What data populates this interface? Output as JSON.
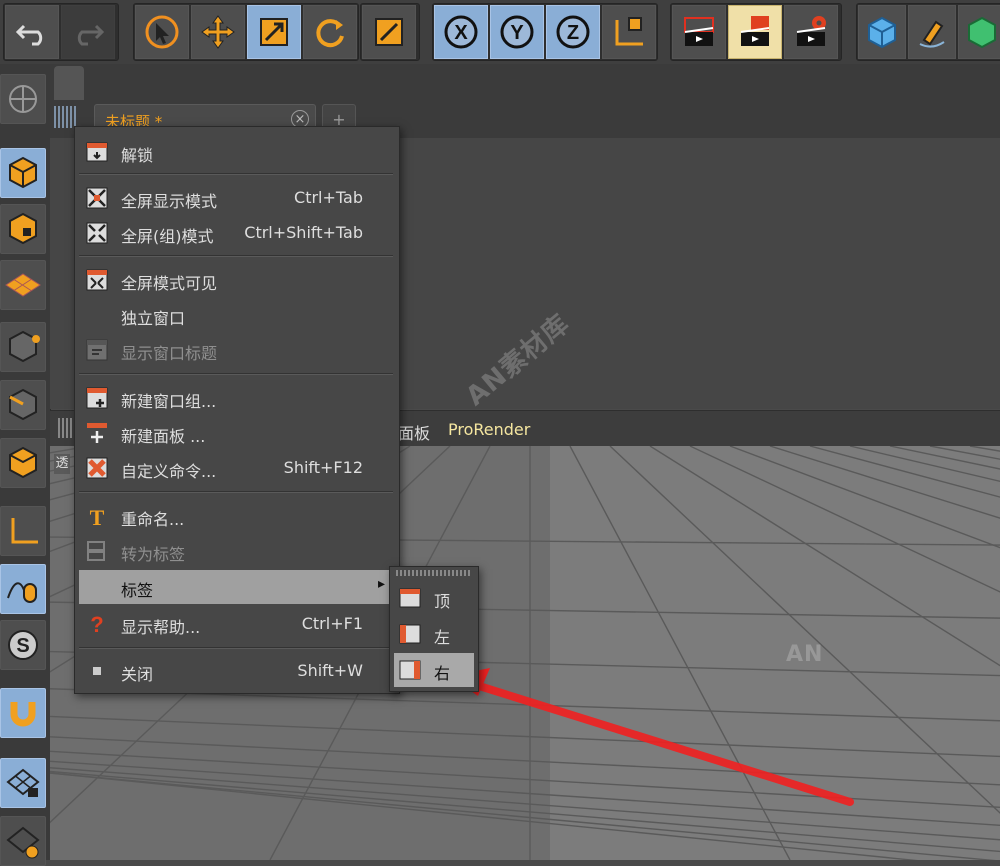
{
  "app": {
    "document_tab": "未标题 *",
    "document_tab_close": "⊗",
    "new_tab": "+"
  },
  "viewport_menu": {
    "items": [
      "面板",
      "ProRender"
    ],
    "colors": {
      "panel": "#dcdcdc",
      "prorender": "#f5e6a0"
    },
    "edge_label": "透"
  },
  "toolbar_icons": [
    "undo-icon",
    "redo-icon",
    "select-icon",
    "move-icon",
    "scale-icon",
    "rotate-icon",
    "coord-icon",
    "x-axis-icon",
    "y-axis-icon",
    "z-axis-icon",
    "world-coordinate-icon",
    "render-view-icon",
    "render-to-picture-viewer-icon",
    "render-settings-icon",
    "cube-icon",
    "pen-icon",
    "green-cube-icon"
  ],
  "left_toolbar_icons": [
    "mode-model-icon",
    "object-mode-icon",
    "texture-mode-icon",
    "workplane-icon",
    "points-icon",
    "edges-icon",
    "polygons-icon",
    "axis-icon",
    "tweak-icon",
    "snap-icon",
    "magnet-icon",
    "lock-grid-icon",
    "workplane-lock-icon"
  ],
  "context_menu": {
    "groups": [
      [
        {
          "label": "解锁",
          "shortcut": "",
          "icon": "unlock-icon",
          "disabled": false
        }
      ],
      [
        {
          "label": "全屏显示模式",
          "shortcut": "Ctrl+Tab",
          "icon": "fullscreen-icon",
          "disabled": false
        },
        {
          "label": "全屏(组)模式",
          "shortcut": "Ctrl+Shift+Tab",
          "icon": "fullscreen-group-icon",
          "disabled": false
        }
      ],
      [
        {
          "label": "全屏模式可见",
          "shortcut": "",
          "icon": "fullscreen-visible-icon",
          "disabled": false
        },
        {
          "label": "独立窗口",
          "shortcut": "",
          "icon": "",
          "disabled": false
        },
        {
          "label": "显示窗口标题",
          "shortcut": "",
          "icon": "window-title-icon",
          "disabled": true
        }
      ],
      [
        {
          "label": "新建窗口组...",
          "shortcut": "",
          "icon": "new-window-group-icon",
          "disabled": false
        },
        {
          "label": "新建面板 ...",
          "shortcut": "",
          "icon": "new-panel-icon",
          "disabled": false
        },
        {
          "label": "自定义命令...",
          "shortcut": "Shift+F12",
          "icon": "custom-commands-icon",
          "disabled": false
        }
      ],
      [
        {
          "label": "重命名...",
          "shortcut": "",
          "icon": "rename-icon",
          "disabled": false
        },
        {
          "label": "转为标签",
          "shortcut": "",
          "icon": "convert-to-tab-icon",
          "disabled": true
        },
        {
          "label": "标签",
          "shortcut": "",
          "icon": "",
          "disabled": false,
          "selected": true,
          "submenu": true
        },
        {
          "label": "显示帮助...",
          "shortcut": "Ctrl+F1",
          "icon": "help-icon",
          "disabled": false
        }
      ],
      [
        {
          "label": "关闭",
          "shortcut": "Shift+W",
          "icon": "close-panel-icon",
          "disabled": false
        }
      ]
    ],
    "submenu_arrow": "▸"
  },
  "tabs_submenu": {
    "items": [
      {
        "label": "顶",
        "icon": "tab-top-icon"
      },
      {
        "label": "左",
        "icon": "tab-left-icon"
      },
      {
        "label": "右",
        "icon": "tab-right-icon",
        "selected": true
      }
    ]
  },
  "watermarks": [
    "AN",
    "AN素材库"
  ],
  "accent_colors": {
    "orange": "#f0a020",
    "selection_blue": "#8aaed6",
    "arrow_red": "#ee2222"
  }
}
